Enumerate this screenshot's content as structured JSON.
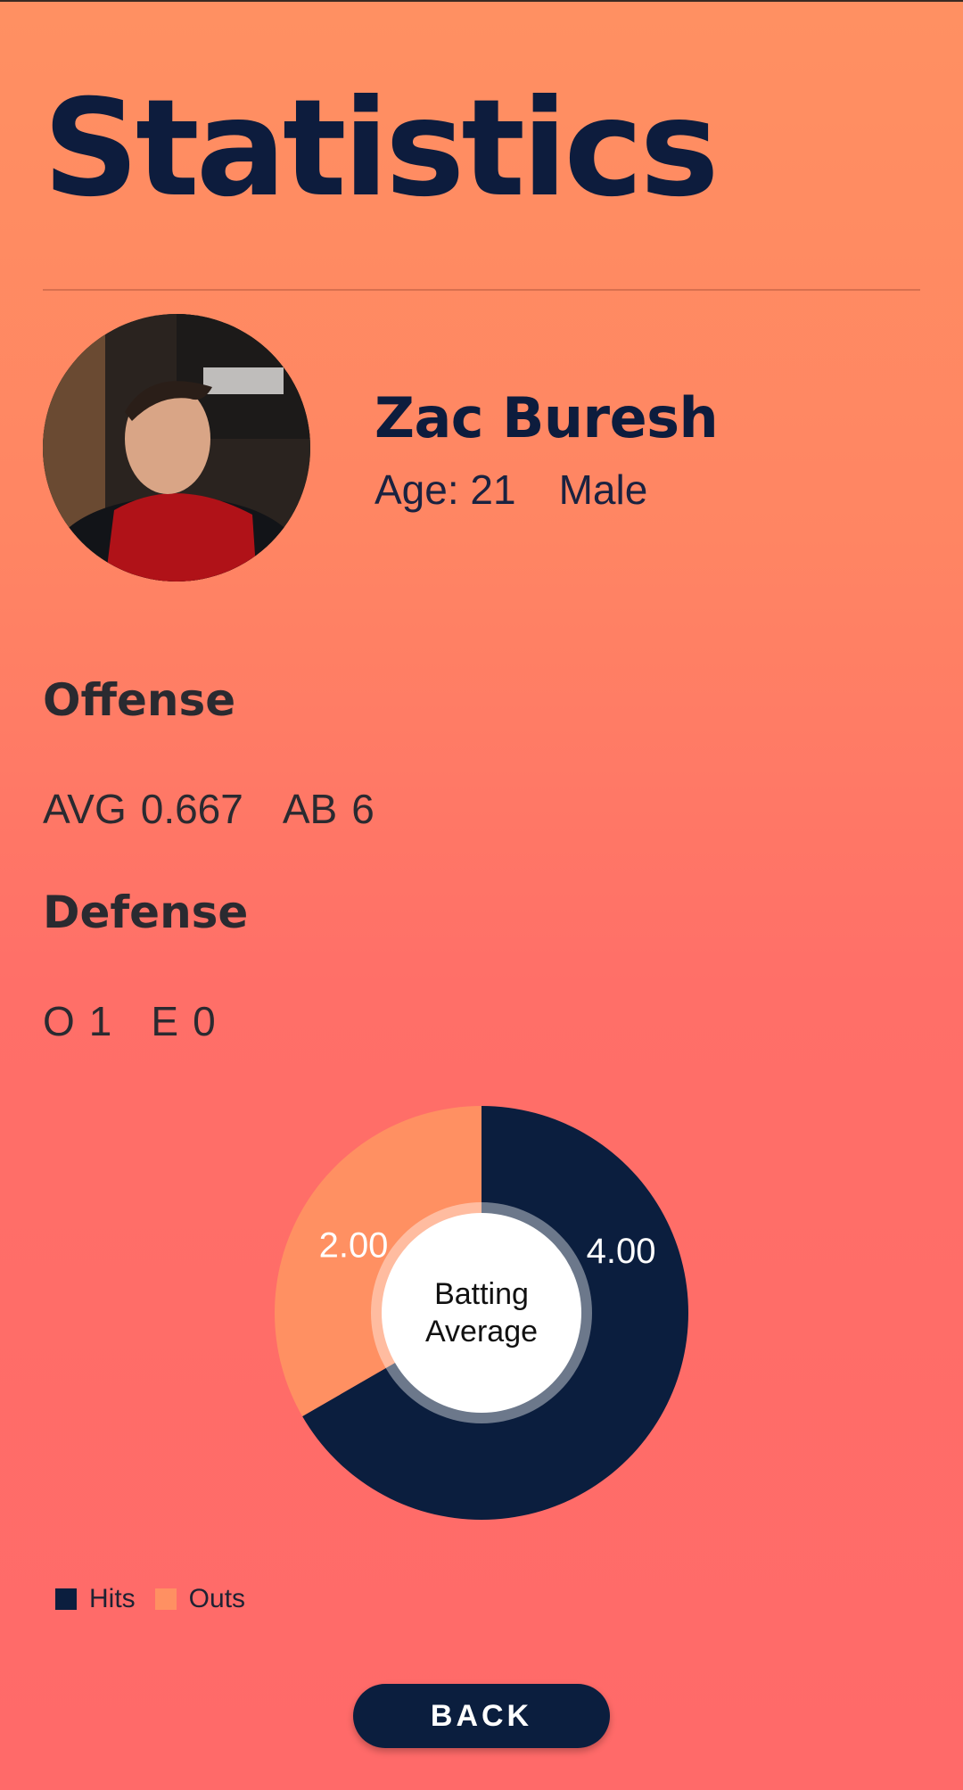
{
  "header": {
    "title": "Statistics"
  },
  "player": {
    "name": "Zac Buresh",
    "age": "Age: 21",
    "gender": "Male"
  },
  "offense": {
    "heading": "Offense",
    "avg_label": "AVG",
    "avg_value": "0.667",
    "ab_label": "AB",
    "ab_value": "6"
  },
  "defense": {
    "heading": "Defense",
    "o_label": "O",
    "o_value": "1",
    "e_label": "E",
    "e_value": "0"
  },
  "chart_data": {
    "type": "pie",
    "center_label": [
      "Batting",
      "Average"
    ],
    "categories": [
      "Hits",
      "Outs"
    ],
    "values": [
      4.0,
      2.0
    ],
    "value_labels": [
      "4.00",
      "2.00"
    ],
    "colors": [
      "#0b1e3e",
      "#ff9062"
    ],
    "legend": "bottom-left"
  },
  "footer": {
    "back_label": "BACK"
  }
}
